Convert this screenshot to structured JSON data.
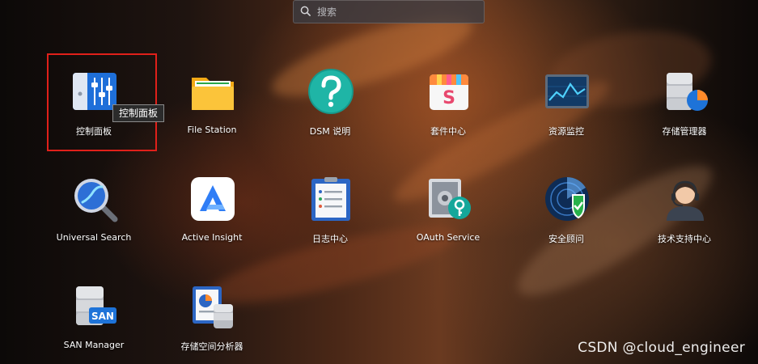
{
  "search": {
    "placeholder": "搜索",
    "icon": "search-icon"
  },
  "apps": [
    {
      "id": "control-panel",
      "label": "控制面板",
      "icon": "control-panel-icon"
    },
    {
      "id": "file-station",
      "label": "File Station",
      "icon": "folder-icon"
    },
    {
      "id": "dsm-help",
      "label": "DSM 说明",
      "icon": "help-icon"
    },
    {
      "id": "package-center",
      "label": "套件中心",
      "icon": "package-center-icon"
    },
    {
      "id": "resource-monitor",
      "label": "资源监控",
      "icon": "resource-monitor-icon"
    },
    {
      "id": "storage-manager",
      "label": "存储管理器",
      "icon": "storage-manager-icon"
    },
    {
      "id": "universal-search",
      "label": "Universal Search",
      "icon": "magnifier-icon"
    },
    {
      "id": "active-insight",
      "label": "Active Insight",
      "icon": "active-insight-icon"
    },
    {
      "id": "log-center",
      "label": "日志中心",
      "icon": "log-center-icon"
    },
    {
      "id": "oauth-service",
      "label": "OAuth Service",
      "icon": "oauth-key-icon"
    },
    {
      "id": "security-advisor",
      "label": "安全顾问",
      "icon": "security-advisor-icon"
    },
    {
      "id": "support-center",
      "label": "技术支持中心",
      "icon": "support-agent-icon"
    },
    {
      "id": "san-manager",
      "label": "SAN Manager",
      "icon": "san-manager-icon"
    },
    {
      "id": "storage-analyzer",
      "label": "存储空间分析器",
      "icon": "storage-analyzer-icon"
    }
  ],
  "tooltip": {
    "text": "控制面板"
  },
  "selection": {
    "target": "控制面板",
    "color": "#e0201a"
  },
  "watermark": {
    "text": "CSDN @cloud_engineer"
  }
}
